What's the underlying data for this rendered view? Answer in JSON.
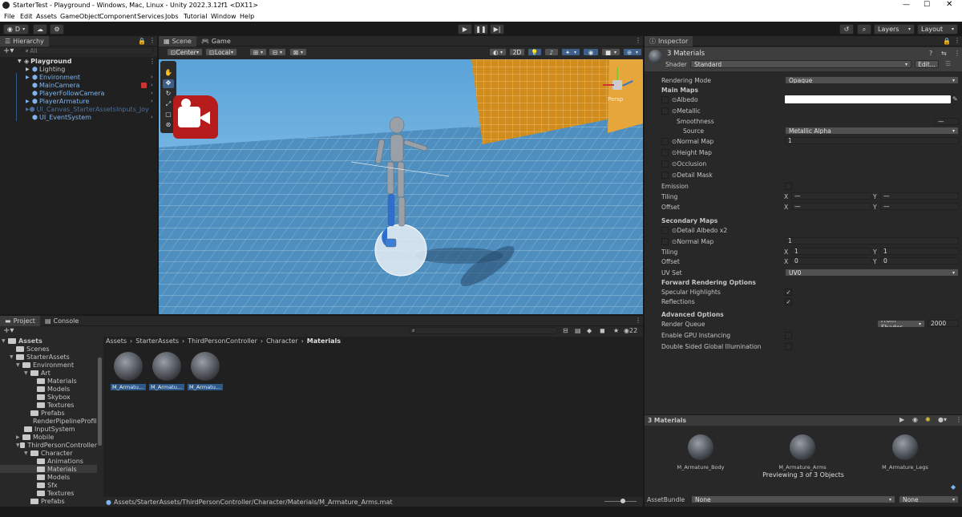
{
  "window": {
    "title": "StarterTest - Playground - Windows, Mac, Linux - Unity 2022.3.12f1 <DX11>"
  },
  "menu": [
    "File",
    "Edit",
    "Assets",
    "GameObject",
    "Component",
    "Services",
    "Jobs",
    "Tutorial",
    "Window",
    "Help"
  ],
  "toolbar": {
    "account": "D",
    "layers": "Layers",
    "layout": "Layout"
  },
  "hierarchy": {
    "tab": "Hierarchy",
    "search_placeholder": "All",
    "scene": "Playground",
    "items": [
      "Lighting",
      "Environment",
      "MainCamera",
      "PlayerFollowCamera",
      "PlayerArmature",
      "UI_Canvas_StarterAssetsInputs_Joystick",
      "UI_EventSystem"
    ]
  },
  "scene_view": {
    "tabs": [
      "Scene",
      "Game"
    ],
    "pivot": "Center",
    "space": "Local",
    "mode2d": "2D",
    "persp": "Persp"
  },
  "project": {
    "tabs": [
      "Project",
      "Console"
    ],
    "tree": [
      "Assets",
      "Scenes",
      "StarterAssets",
      "Environment",
      "Art",
      "Materials",
      "Models",
      "Skybox",
      "Textures",
      "Prefabs",
      "RenderPipelineProfiles",
      "InputSystem",
      "Mobile",
      "ThirdPersonController",
      "Character",
      "Animations",
      "Materials",
      "Models",
      "Sfx",
      "Textures",
      "Prefabs"
    ],
    "breadcrumb": [
      "Assets",
      "StarterAssets",
      "ThirdPersonController",
      "Character",
      "Materials"
    ],
    "assets": [
      "M_Armatu...",
      "M_Armatu...",
      "M_Armatu..."
    ],
    "count": "22",
    "path": "Assets/StarterAssets/ThirdPersonController/Character/Materials/M_Armature_Arms.mat"
  },
  "inspector": {
    "tab": "Inspector",
    "title": "3 Materials",
    "shader_label": "Shader",
    "shader": "Standard",
    "edit_button": "Edit...",
    "rendering_mode_label": "Rendering Mode",
    "rendering_mode": "Opaque",
    "main_maps": "Main Maps",
    "albedo": "Albedo",
    "metallic": "Metallic",
    "smoothness": "Smoothness",
    "source_label": "Source",
    "source": "Metallic Alpha",
    "normal_map": "Normal Map",
    "normal_value": "1",
    "height_map": "Height Map",
    "occlusion": "Occlusion",
    "detail_mask": "Detail Mask",
    "emission": "Emission",
    "tiling": "Tiling",
    "offset": "Offset",
    "x": "X",
    "y": "Y",
    "dash": "—",
    "secondary_maps": "Secondary Maps",
    "detail_albedo": "Detail Albedo x2",
    "normal_map2": "Normal Map",
    "normal_value2": "1",
    "tiling_x": "1",
    "tiling_y": "1",
    "offset_x": "0",
    "offset_y": "0",
    "uv_set_label": "UV Set",
    "uv_set": "UV0",
    "forward_options": "Forward Rendering Options",
    "specular": "Specular Highlights",
    "reflections": "Reflections",
    "advanced": "Advanced Options",
    "render_queue": "Render Queue",
    "render_queue_mode": "From Shader",
    "render_queue_value": "2000",
    "gpu_instancing": "Enable GPU Instancing",
    "double_sided": "Double Sided Global Illumination",
    "preview_title": "3 Materials",
    "previews": [
      "M_Armature_Body",
      "M_Armature_Arms",
      "M_Armature_Legs"
    ],
    "previewing": "Previewing 3 of 3 Objects",
    "assetbundle_label": "AssetBundle",
    "assetbundle": "None",
    "assetbundle_variant": "None"
  }
}
